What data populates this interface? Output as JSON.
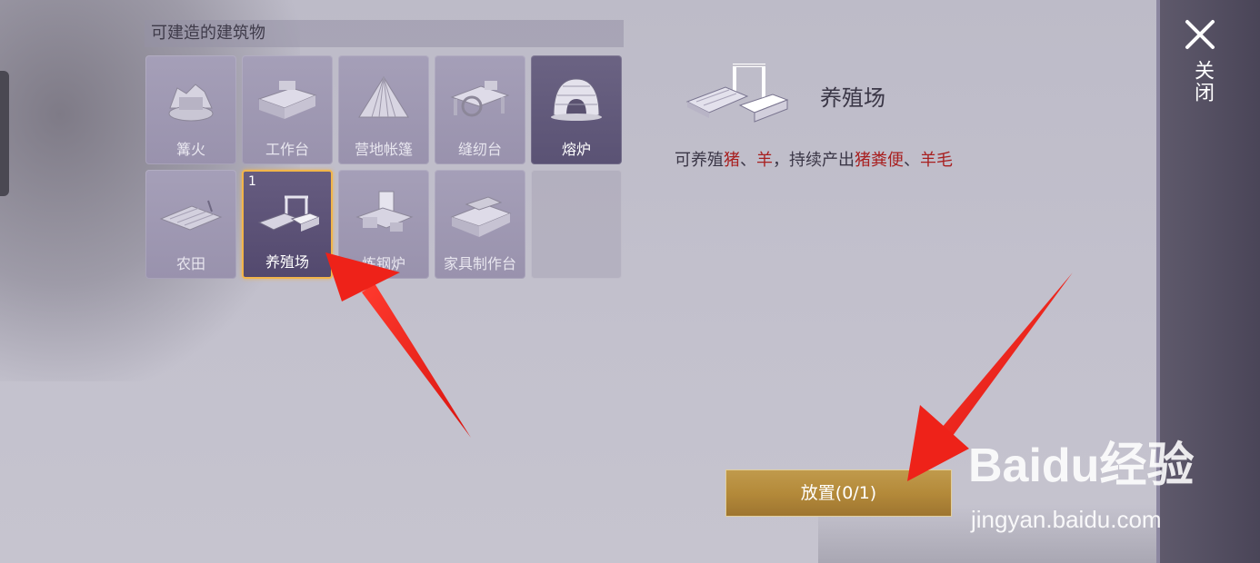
{
  "panel": {
    "section_title": "可建造的建筑物",
    "close_label": "关闭"
  },
  "buildings": [
    {
      "label": "篝火",
      "icon": "campfire-icon"
    },
    {
      "label": "工作台",
      "icon": "workbench-icon"
    },
    {
      "label": "营地帐篷",
      "icon": "tent-icon"
    },
    {
      "label": "缝纫台",
      "icon": "sewing-table-icon"
    },
    {
      "label": "熔炉",
      "icon": "furnace-icon"
    },
    {
      "label": "农田",
      "icon": "farmland-icon"
    },
    {
      "label": "养殖场",
      "icon": "ranch-icon",
      "count": "1"
    },
    {
      "label": "炼钢炉",
      "icon": "steel-furnace-icon"
    },
    {
      "label": "家具制作台",
      "icon": "furniture-bench-icon"
    }
  ],
  "detail": {
    "title": "养殖场",
    "desc_prefix": "可养殖",
    "desc_animal1": "猪",
    "desc_sep1": "、",
    "desc_animal2": "羊",
    "desc_mid": "，持续产出",
    "desc_product1": "猪粪便",
    "desc_sep2": "、",
    "desc_product2": "羊毛"
  },
  "place_button": {
    "label": "放置(0/1)"
  },
  "watermark": {
    "main": "Baidu经验",
    "sub": "jingyan.baidu.com"
  },
  "colors": {
    "selected_border": "#f2b54a",
    "highlight_text": "#a81f1f",
    "button_gold": "#b48a3a",
    "arrow": "#e8201c"
  }
}
